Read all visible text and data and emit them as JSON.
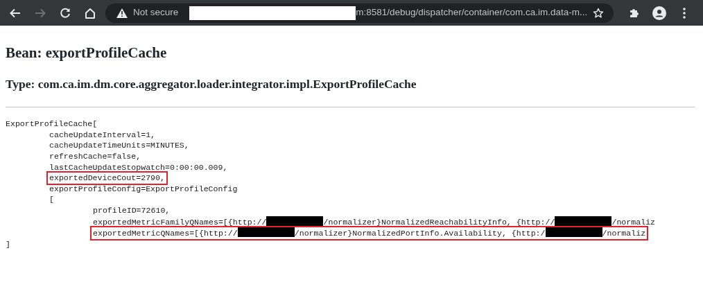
{
  "browser": {
    "back_disabled": false,
    "forward_disabled": true,
    "security_label": "Not secure",
    "url": [
      {
        "kind": "redaction"
      },
      {
        "kind": "text",
        "text": "m:8581/debug/dispatcher/container/com.ca.im.data-m..."
      }
    ]
  },
  "heading": "Bean: exportProfileCache",
  "subheading": "Type: com.ca.im.dm.core.aggregator.loader.integrator.impl.ExportProfileCache",
  "code_lines": [
    {
      "parts": [
        {
          "kind": "text",
          "text": "ExportProfileCache["
        }
      ],
      "highlighted": false,
      "children": [
        {
          "parts": [
            {
              "kind": "text",
              "text": "cacheUpdateInterval=1,"
            }
          ],
          "highlighted": false
        },
        {
          "parts": [
            {
              "kind": "text",
              "text": "cacheUpdateTimeUnits=MINUTES,"
            }
          ],
          "highlighted": false
        },
        {
          "parts": [
            {
              "kind": "text",
              "text": "refreshCache=false,"
            }
          ],
          "highlighted": false
        },
        {
          "parts": [
            {
              "kind": "text",
              "text": "lastCacheUpdateStopwatch=0:00:00.009,"
            }
          ],
          "highlighted": false
        },
        {
          "parts": [
            {
              "kind": "text",
              "text": "exportedDeviceCout=2790,"
            }
          ],
          "highlighted": true
        },
        {
          "parts": [
            {
              "kind": "text",
              "text": "exportProfileConfig=ExportProfileConfig"
            }
          ],
          "highlighted": false
        },
        {
          "parts": [
            {
              "kind": "text",
              "text": "["
            }
          ],
          "highlighted": false,
          "children": [
            {
              "parts": [
                {
                  "kind": "text",
                  "text": "profileID=72610,"
                }
              ],
              "highlighted": false
            },
            {
              "parts": [
                {
                  "kind": "text",
                  "text": "exportedMetricFamilyQNames=[{http://"
                },
                {
                  "kind": "redaction"
                },
                {
                  "kind": "text",
                  "text": "/normalizer}NormalizedReachabilityInfo, {http://"
                },
                {
                  "kind": "redaction"
                },
                {
                  "kind": "text",
                  "text": "/normaliz"
                }
              ],
              "highlighted": false
            },
            {
              "parts": [
                {
                  "kind": "text",
                  "text": "exportedMetricQNames=[{http://"
                },
                {
                  "kind": "redaction"
                },
                {
                  "kind": "text",
                  "text": "/normalizer}NormalizedPortInfo.Availability, {http:/"
                },
                {
                  "kind": "redaction"
                },
                {
                  "kind": "text",
                  "text": "/normaliz"
                }
              ],
              "highlighted": true
            }
          ]
        }
      ]
    },
    {
      "parts": [
        {
          "kind": "text",
          "text": "]"
        }
      ],
      "highlighted": false
    }
  ]
}
